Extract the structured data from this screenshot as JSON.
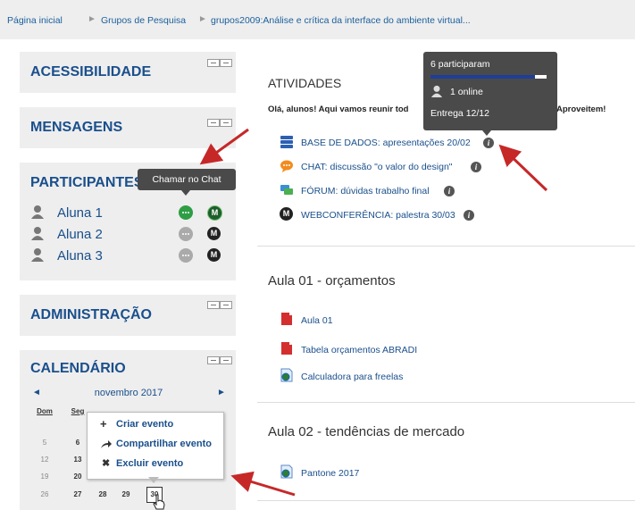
{
  "breadcrumb": {
    "items": [
      "Página inicial",
      "Grupos de Pesquisa",
      "grupos2009:Análise e crítica da interface do ambiente virtual..."
    ],
    "separator": "►"
  },
  "sidebar": {
    "accessibility_title": "ACESSIBILIDADE",
    "messages_title": "MENSAGENS",
    "participants_title": "PARTICIPANTES",
    "participants": [
      "Aluna 1",
      "Aluna 2",
      "Aluna 3"
    ],
    "chat_tooltip": "Chamar no Chat",
    "administration_title": "ADMINISTRAÇÃO",
    "calendar_title": "CALENDÁRIO"
  },
  "calendar": {
    "month": "novembro 2017",
    "prev": "◄",
    "next": "►",
    "weekdays": [
      "Dom",
      "Seg"
    ],
    "rows": [
      [
        "5",
        "6"
      ],
      [
        "12",
        "13"
      ],
      [
        "19",
        "20"
      ],
      [
        "26",
        "27",
        "28",
        "29",
        "30"
      ]
    ],
    "menu": [
      "Criar evento",
      "Compartilhar evento",
      "Excluir evento"
    ]
  },
  "main": {
    "activities_title": "ATIVIDADES",
    "intro_left": "Olá, alunos! Aqui vamos reunir tod",
    "intro_right": "Aproveitem!",
    "tooltip": {
      "participated": "6 participaram",
      "online": "1 online",
      "due": "Entrega 12/12",
      "progress": 0.9
    },
    "activities": [
      "BASE DE DADOS: apresentações 20/02",
      "CHAT: discussão \"o valor do design\"",
      "FÓRUM: dúvidas trabalho final",
      "WEBCONFERÊNCIA: palestra 30/03"
    ],
    "section1": {
      "title": "Aula 01 - orçamentos",
      "items": [
        "Aula 01",
        "Tabela orçamentos ABRADI",
        "Calculadora para freelas"
      ]
    },
    "section2": {
      "title": "Aula 02 - tendências de mercado",
      "items": [
        "Pantone 2017"
      ]
    }
  },
  "colors": {
    "link": "#1a4f8c",
    "arrow": "#c62828",
    "chat_active": "#2e9e44",
    "tooltip_bg": "#4a4a4a"
  }
}
